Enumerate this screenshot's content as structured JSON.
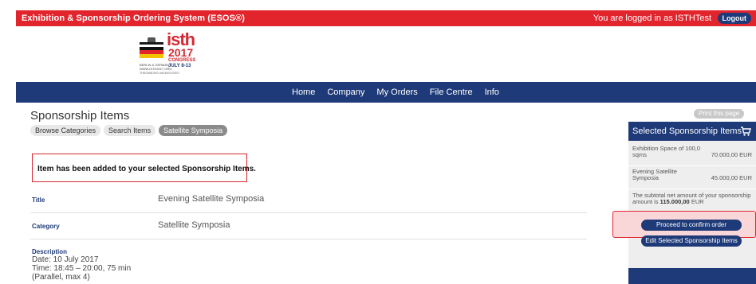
{
  "topbar": {
    "app_title": "Exhibition & Sponsorship Ordering System (ESOS®)",
    "login_text": "You are logged in as ISTHTest",
    "logout_label": "Logout"
  },
  "logo": {
    "isth": "isth",
    "year": "2017",
    "congress": "CONGRESS",
    "dates": "JULY 8-13",
    "line1": "BERLIN & GERMANY",
    "line2": "WWW.ISTH2017.ORG",
    "line3": "THROMBOSIS HAEMOSTASIS"
  },
  "nav": {
    "items": [
      "Home",
      "Company",
      "My Orders",
      "File Centre",
      "Info"
    ]
  },
  "page": {
    "title": "Sponsorship Items",
    "tabs": [
      "Browse Categories",
      "Search Items",
      "Satellite Symposia"
    ],
    "alert": "Item has been added to your selected Sponsorship Items.",
    "fields": {
      "title_label": "Title",
      "title_value": "Evening Satellite Symposia",
      "category_label": "Category",
      "category_value": "Satellite Symposia",
      "description_label": "Description",
      "description_lines": [
        "Date: 10 July 2017",
        "Time: 18:45 – 20:00, 75 min",
        "(Parallel, max 4)"
      ]
    }
  },
  "sidebar": {
    "print_label": "Print this page",
    "title": "Selected Sponsorship Items",
    "items": [
      {
        "name": "Exhibition Space of 100,0 sqms",
        "price": "70.000,00 EUR"
      },
      {
        "name": "Evening Satellite Symposia",
        "price": "45.000,00 EUR"
      }
    ],
    "subtotal_prefix": "The subtotal net amount of your sponsorship amount is ",
    "subtotal_value": "115.000,00",
    "subtotal_suffix": " EUR",
    "proceed_label": "Proceed to confirm order",
    "edit_label": "Edit Selected Sponsorship Items"
  },
  "colors": {
    "brand_red": "#e2252d",
    "brand_navy": "#1e3a78"
  }
}
